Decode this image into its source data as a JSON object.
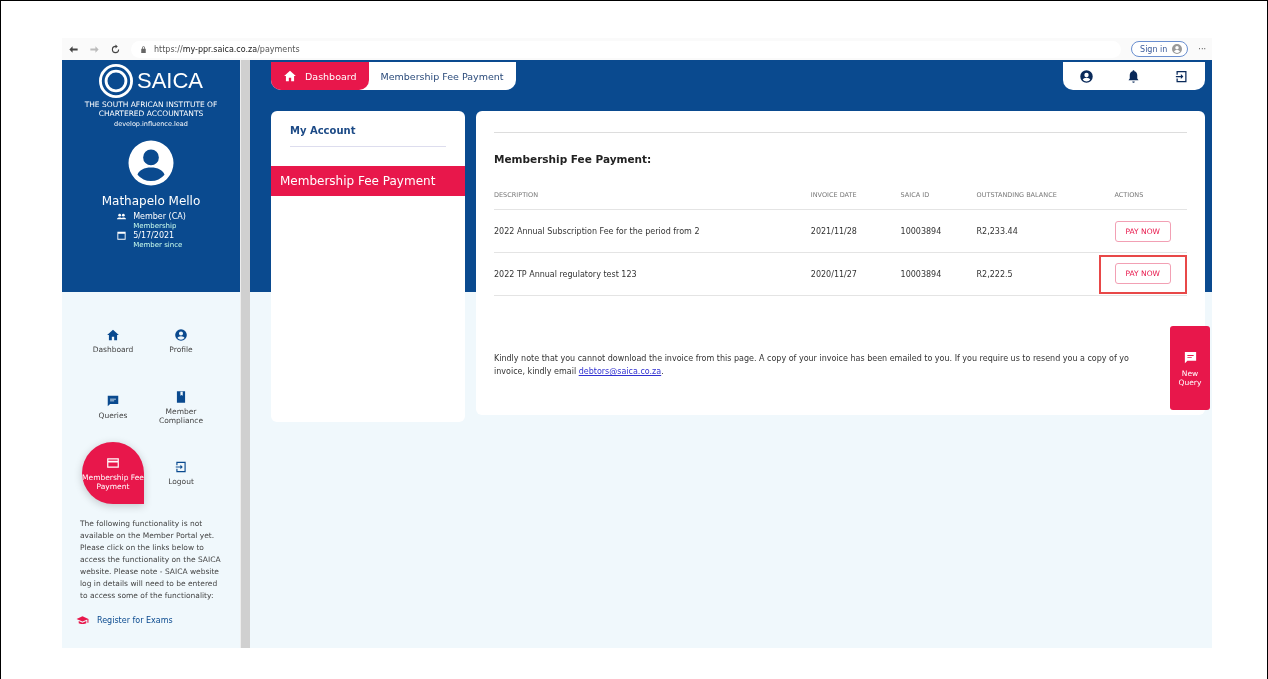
{
  "browser": {
    "url": {
      "scheme": "https://",
      "host": "my-ppr.saica.co.za",
      "path": "/payments"
    },
    "sign_in": "Sign in",
    "more": "···"
  },
  "sidebar": {
    "logo": {
      "name": "SAICA",
      "subtitle": "THE SOUTH AFRICAN INSTITUTE OF CHARTERED ACCOUNTANTS",
      "tagline": "develop.influence.lead"
    },
    "user": {
      "name": "Mathapelo Mello",
      "membership": "Member (CA)",
      "membership_label": "Membership",
      "since": "5/17/2021",
      "since_label": "Member since"
    },
    "nav": [
      {
        "label": "Dashboard",
        "selected": false
      },
      {
        "label": "Profile",
        "selected": false
      },
      {
        "label": "Queries",
        "selected": false
      },
      {
        "label": "Member Compliance",
        "selected": false
      },
      {
        "label": "Membership Fee Payment",
        "selected": true
      },
      {
        "label": "Logout",
        "selected": false
      }
    ],
    "notice": "The following functionality is not available on the Member Portal yet. Please click on the links below to access the functionality on the SAICA website. Please note - SAICA website log in details will need to be entered to access some of the functionality:",
    "links": [
      "Register for Exams"
    ]
  },
  "breadcrumb": [
    {
      "label": "Dashboard",
      "selected": true
    },
    {
      "label": "Membership Fee Payment",
      "selected": false
    }
  ],
  "account_menu": {
    "title": "My Account",
    "items": [
      {
        "label": "Membership Fee Payment",
        "selected": true
      }
    ]
  },
  "payments": {
    "title": "Membership Fee Payment:",
    "columns": [
      "DESCRIPTION",
      "INVOICE DATE",
      "SAICA ID",
      "OUTSTANDING BALANCE",
      "ACTIONS"
    ],
    "rows": [
      {
        "description": "2022 Annual Subscription Fee for the period from 2",
        "invoice_date": "2021/11/28",
        "saica_id": "10003894",
        "balance": "R2,233.44",
        "action": "PAY NOW",
        "highlighted": false
      },
      {
        "description": "2022 TP Annual regulatory test 123",
        "invoice_date": "2020/11/27",
        "saica_id": "10003894",
        "balance": "R2,222.5",
        "action": "PAY NOW",
        "highlighted": true
      }
    ],
    "note_line": "Kindly note that you cannot download the invoice from this page. A copy of your invoice has been emailed to you. If you require us to resend you a copy of yo",
    "note_prefix": "invoice, kindly email",
    "note_link": "debtors@saica.co.za",
    "note_suffix": "."
  },
  "new_query": "New Query"
}
